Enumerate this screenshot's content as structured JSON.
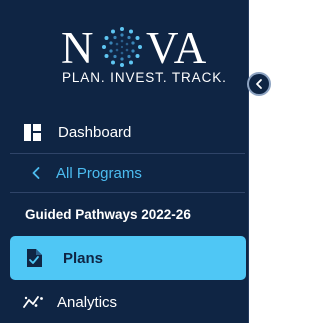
{
  "logo": {
    "letter_n": "N",
    "letters_va": "VA",
    "tagline": "PLAN. INVEST. TRACK."
  },
  "nav": {
    "dashboard": {
      "label": "Dashboard",
      "icon": "dashboard-icon"
    },
    "back": {
      "label": "All Programs",
      "icon": "chevron-left-icon"
    },
    "program_title": "Guided Pathways 2022-26",
    "plans": {
      "label": "Plans",
      "icon": "document-check-icon",
      "active": true
    },
    "analytics": {
      "label": "Analytics",
      "icon": "analytics-icon"
    }
  },
  "colors": {
    "sidebar_bg": "#0f2544",
    "accent": "#4fc7f5",
    "link": "#4cbcf0",
    "text": "#ffffff"
  }
}
